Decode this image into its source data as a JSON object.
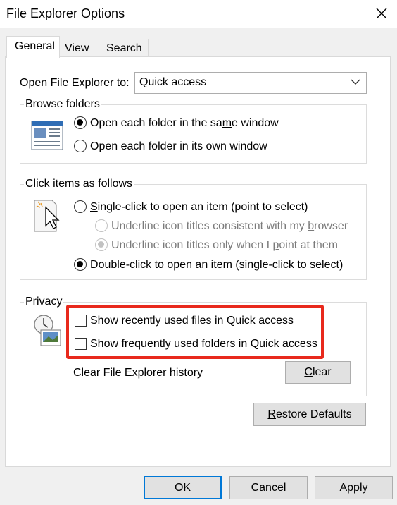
{
  "window": {
    "title": "File Explorer Options"
  },
  "tabs": [
    {
      "label": "General"
    },
    {
      "label": "View"
    },
    {
      "label": "Search"
    }
  ],
  "general": {
    "open_to_label": "Open File Explorer to:",
    "open_to_value": "Quick access",
    "browse_folders": {
      "title": "Browse folders",
      "same_window": "Open each folder in the same window",
      "own_window": "Open each folder in its own window",
      "selected": "same_window"
    },
    "click_items": {
      "title": "Click items as follows",
      "single_click": "Single-click to open an item (point to select)",
      "underline_browser": "Underline icon titles consistent with my browser",
      "underline_point": "Underline icon titles only when I point at them",
      "double_click": "Double-click to open an item (single-click to select)",
      "selected": "double_click"
    },
    "privacy": {
      "title": "Privacy",
      "show_recent_files": "Show recently used files in Quick access",
      "show_frequent_folders": "Show frequently used folders in Quick access",
      "show_recent_files_checked": false,
      "show_frequent_folders_checked": false,
      "clear_history_label": "Clear File Explorer history",
      "clear_button": "Clear",
      "highlight_color": "#e8291c"
    },
    "restore_defaults": "Restore Defaults"
  },
  "footer": {
    "ok": "OK",
    "cancel": "Cancel",
    "apply": "Apply"
  },
  "icons": {
    "close": "close-icon",
    "dropdown": "chevron-down-icon",
    "browse": "window-icon",
    "click": "pointer-icon",
    "privacy": "clock-picture-icon"
  },
  "colors": {
    "accent": "#0078d7",
    "highlight": "#e8291c"
  }
}
